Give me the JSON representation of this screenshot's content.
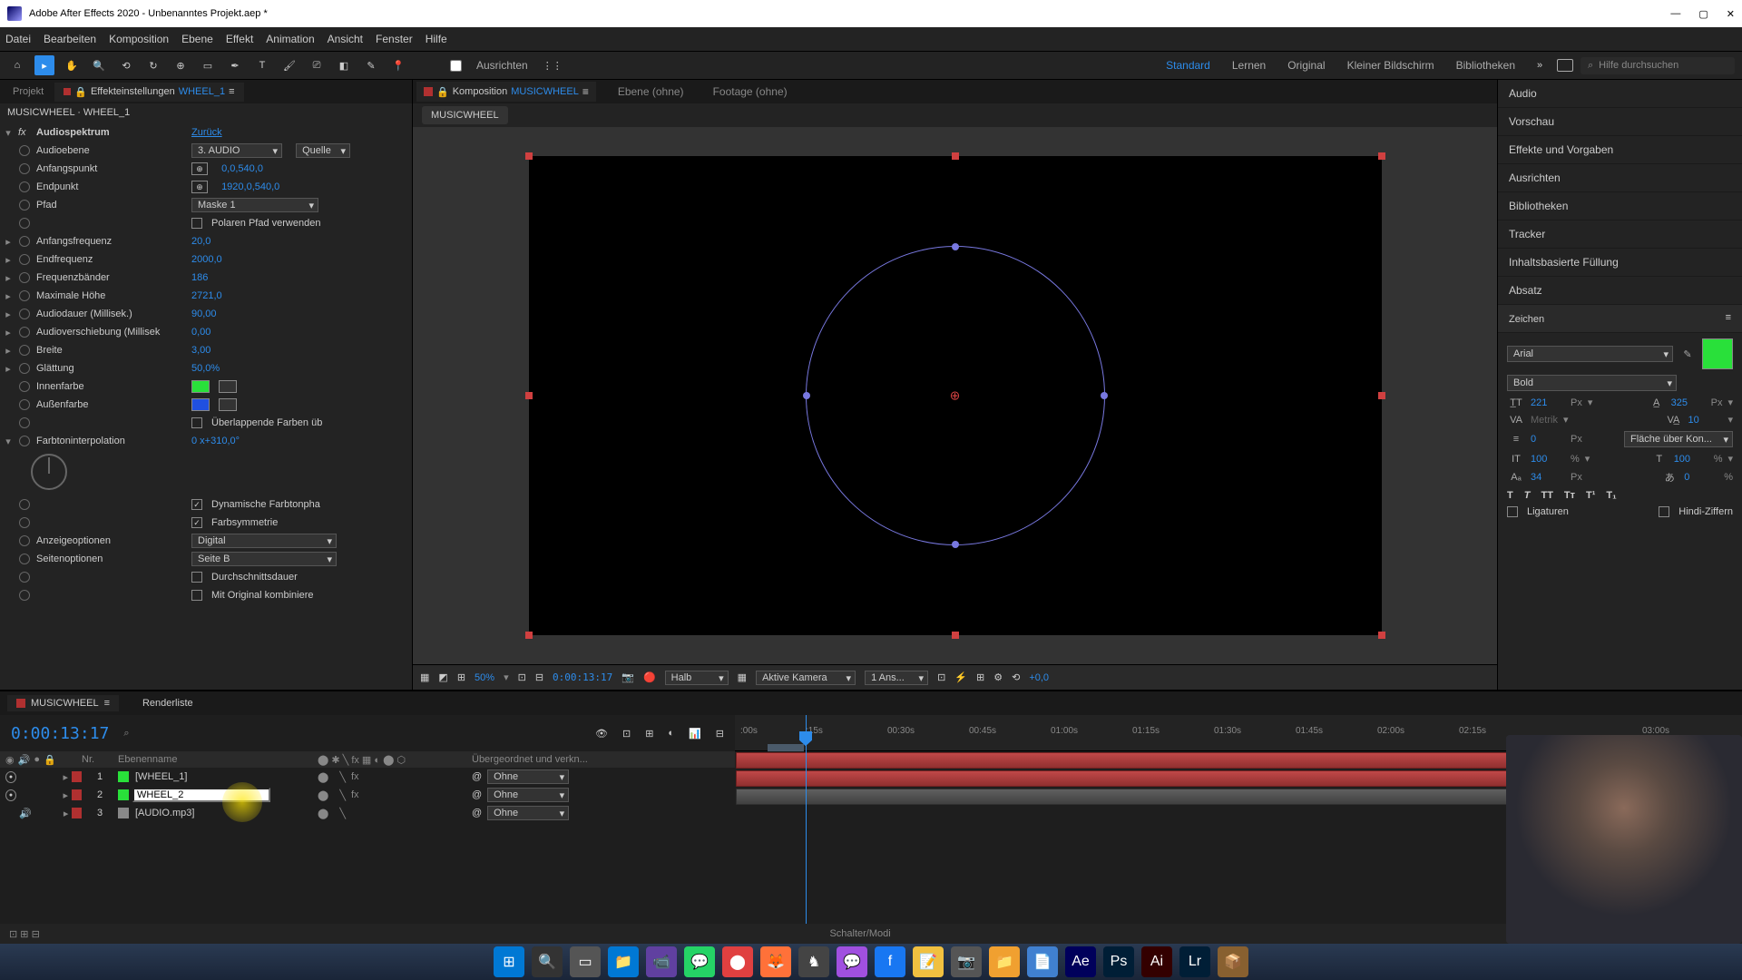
{
  "titlebar": {
    "app": "Adobe After Effects 2020 - Unbenanntes Projekt.aep *"
  },
  "menu": [
    "Datei",
    "Bearbeiten",
    "Komposition",
    "Ebene",
    "Effekt",
    "Animation",
    "Ansicht",
    "Fenster",
    "Hilfe"
  ],
  "toolbar": {
    "align": "Ausrichten",
    "workspaces": [
      "Standard",
      "Lernen",
      "Original",
      "Kleiner Bildschirm",
      "Bibliotheken"
    ],
    "search_ph": "Hilfe durchsuchen"
  },
  "project": {
    "tab_project": "Projekt",
    "tab_effect": "Effekteinstellungen",
    "effect_layer": "WHEEL_1",
    "breadcrumb": "MUSICWHEEL · WHEEL_1"
  },
  "effect": {
    "name": "Audiospektrum",
    "reset": "Zurück",
    "audio_label": "Audioebene",
    "audio_val": "3. AUDIO",
    "source": "Quelle",
    "start_label": "Anfangspunkt",
    "start_val": "0,0,540,0",
    "end_label": "Endpunkt",
    "end_val": "1920,0,540,0",
    "path_label": "Pfad",
    "path_val": "Maske 1",
    "polar": "Polaren Pfad verwenden",
    "startfreq_label": "Anfangsfrequenz",
    "startfreq_val": "20,0",
    "endfreq_label": "Endfrequenz",
    "endfreq_val": "2000,0",
    "bands_label": "Frequenzbänder",
    "bands_val": "186",
    "maxh_label": "Maximale Höhe",
    "maxh_val": "2721,0",
    "dur_label": "Audiodauer (Millisek.)",
    "dur_val": "90,00",
    "offset_label": "Audioverschiebung (Millisek",
    "offset_val": "0,00",
    "thick_label": "Breite",
    "thick_val": "3,00",
    "soft_label": "Glättung",
    "soft_val": "50,0%",
    "inner_label": "Innenfarbe",
    "outer_label": "Außenfarbe",
    "overlap": "Überlappende Farben üb",
    "hue_label": "Farbtoninterpolation",
    "hue_val": "0 x+310,0°",
    "dyn": "Dynamische Farbtonpha",
    "sym": "Farbsymmetrie",
    "display_label": "Anzeigeoptionen",
    "display_val": "Digital",
    "side_label": "Seitenoptionen",
    "side_val": "Seite B",
    "avg": "Durchschnittsdauer",
    "comp": "Mit Original kombiniere"
  },
  "comp": {
    "tab_comp": "Komposition",
    "comp_name": "MUSICWHEEL",
    "tab_layer": "Ebene (ohne)",
    "tab_footage": "Footage (ohne)",
    "sub": "MUSICWHEEL",
    "zoom": "50%",
    "time": "0:00:13:17",
    "res": "Halb",
    "cam": "Aktive Kamera",
    "view": "1 Ans...",
    "exp": "+0,0"
  },
  "right": {
    "panels": [
      "Audio",
      "Vorschau",
      "Effekte und Vorgaben",
      "Ausrichten",
      "Bibliotheken",
      "Tracker",
      "Inhaltsbasierte Füllung",
      "Absatz"
    ],
    "char_title": "Zeichen",
    "font": "Arial",
    "weight": "Bold",
    "size": "221",
    "size_u": "Px",
    "lead": "325",
    "lead_u": "Px",
    "kern": "Metrik",
    "track": "10",
    "shift": "0",
    "shift_u": "Px",
    "fill": "Fläche über Kon...",
    "vsc": "100",
    "vsc_u": "%",
    "hsc": "100",
    "hsc_u": "%",
    "base": "34",
    "base_u": "Px",
    "tsume": "0",
    "tsume_u": "%",
    "lig": "Ligaturen",
    "hindi": "Hindi-Ziffern"
  },
  "timeline": {
    "tab": "MUSICWHEEL",
    "render": "Renderliste",
    "time": "0:00:13:17",
    "hdr_nr": "Nr.",
    "hdr_name": "Ebenenname",
    "hdr_parent": "Übergeordnet und verkn...",
    "layers": [
      {
        "n": "1",
        "name": "[WHEEL_1]",
        "color": "#29e03a",
        "parent": "Ohne",
        "eye": true,
        "spk": false
      },
      {
        "n": "2",
        "name": "WHEEL_2",
        "color": "#29e03a",
        "parent": "Ohne",
        "eye": true,
        "spk": false,
        "editing": true
      },
      {
        "n": "3",
        "name": "[AUDIO.mp3]",
        "color": "#888",
        "parent": "Ohne",
        "eye": false,
        "spk": true
      }
    ],
    "ticks": [
      ":00s",
      ":15s",
      "00:30s",
      "00:45s",
      "01:00s",
      "01:15s",
      "01:30s",
      "01:45s",
      "02:00s",
      "02:15s",
      "03:00s"
    ],
    "footer": "Schalter/Modi"
  },
  "taskbar": [
    "⊞",
    "🔍",
    "▭",
    "📁",
    "📹",
    "💬",
    "⬤",
    "🦊",
    "♞",
    "💬",
    "f",
    "📝",
    "📷",
    "📁",
    "📄",
    "Ae",
    "Ps",
    "Ai",
    "Lr",
    "📦"
  ]
}
